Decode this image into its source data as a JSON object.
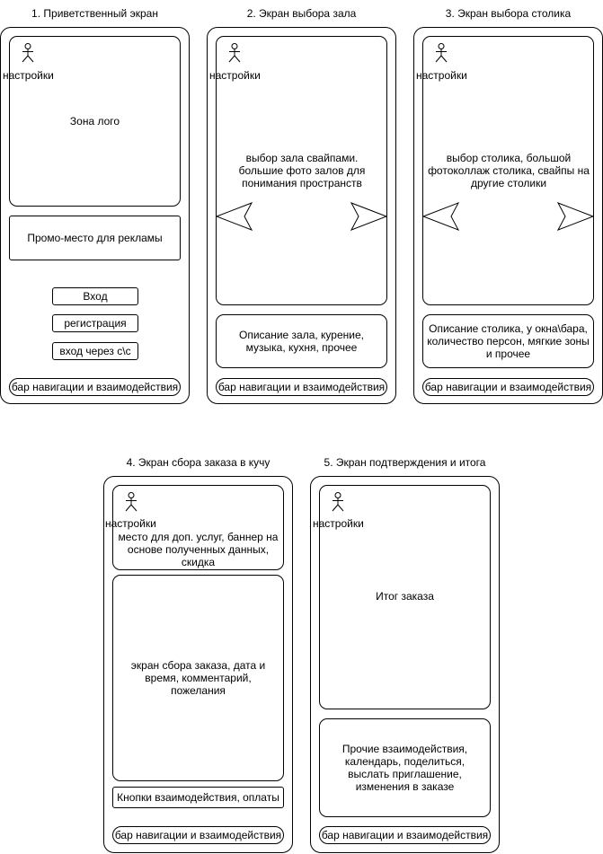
{
  "screens": [
    {
      "title": "1. Приветственный экран",
      "settings_label": "настройки",
      "logo_zone": "Зона лого",
      "promo": "Промо-место для рекламы",
      "buttons": [
        "Вход",
        "регистрация",
        "вход через с\\с"
      ],
      "nav_bar": "бар навигации и взаимодействия"
    },
    {
      "title": "2. Экран выбора зала",
      "settings_label": "настройки",
      "main_text": "выбор зала свайпами. большие фото залов для понимания пространств",
      "description": "Описание зала, курение, музыка, кухня, прочее",
      "nav_bar": "бар навигации и взаимодействия"
    },
    {
      "title": "3. Экран выбора столика",
      "settings_label": "настройки",
      "main_text": "выбор столика, большой фотоколлаж столика, свайпы на другие столики",
      "description": "Описание столика, у окна\\бара, количество персон, мягкие зоны и прочее",
      "nav_bar": "бар навигации и взаимодействия"
    },
    {
      "title": "4. Экран сбора заказа в кучу",
      "settings_label": "настройки",
      "banner": "место для доп. услуг, баннер на основе полученных данных, скидка",
      "main_text": "экран сбора заказа, дата и время, комментарий, пожелания",
      "buttons_box": "Кнопки взаимодействия, оплаты",
      "nav_bar": "бар навигации и взаимодействия"
    },
    {
      "title": "5. Экран подтверждения и итога",
      "settings_label": "настройки",
      "main_text": "Итог заказа",
      "other": "Прочие взаимодействия, календарь, поделиться, выслать приглашение, изменения в заказе",
      "nav_bar": "бар навигации и взаимодействия"
    }
  ]
}
